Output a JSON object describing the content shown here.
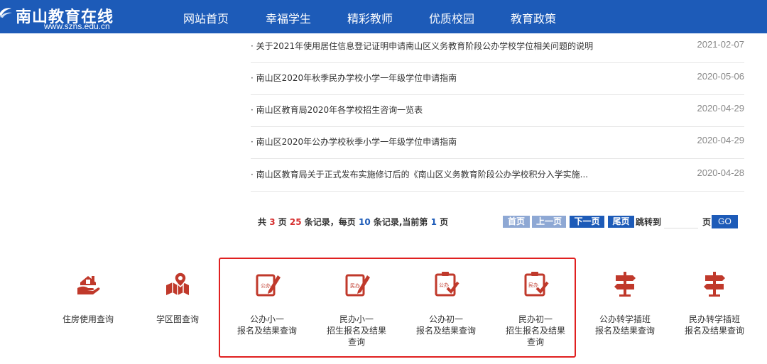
{
  "header": {
    "site_title": "南山教育在线",
    "site_url": "www.szns.edu.cn",
    "nav": [
      "网站首页",
      "幸福学生",
      "精彩教师",
      "优质校园",
      "教育政策"
    ]
  },
  "news": [
    {
      "title": "· 关于2021年使用居住信息登记证明申请南山区义务教育阶段公办学校学位相关问题的说明",
      "date": "2021-02-07"
    },
    {
      "title": "· 南山区2020年秋季民办学校小学一年级学位申请指南",
      "date": "2020-05-06"
    },
    {
      "title": "· 南山区教育局2020年各学校招生咨询一览表",
      "date": "2020-04-29"
    },
    {
      "title": "· 南山区2020年公办学校秋季小学一年级学位申请指南",
      "date": "2020-04-29"
    },
    {
      "title": "· 南山区教育局关于正式发布实施修订后的《南山区义务教育阶段公办学校积分入学实施...",
      "date": "2020-04-28"
    }
  ],
  "pager": {
    "t1": "共 ",
    "total_pages": "3",
    "t2": " 页 ",
    "total_records": "25",
    "t3": " 条记录，每页 ",
    "per_page": "10",
    "t4": " 条记录,当前第 ",
    "current": "1",
    "t5": " 页",
    "first": "首页",
    "prev": "上一页",
    "next": "下一页",
    "last": "尾页",
    "jump_label": "跳转到",
    "page_unit": "页",
    "go": "GO"
  },
  "services": [
    {
      "line1": "住房使用查询",
      "line2": "",
      "line3": "",
      "icon": "house-hand-icon"
    },
    {
      "line1": "学区图查询",
      "line2": "",
      "line3": "",
      "icon": "map-pin-icon"
    },
    {
      "line1": "公办小一",
      "line2": "报名及结果查询",
      "line3": "",
      "icon": "public-primary-icon",
      "badge": "公办"
    },
    {
      "line1": "民办小一",
      "line2": "招生报名及结果",
      "line3": "查询",
      "icon": "private-primary-icon",
      "badge": "民办"
    },
    {
      "line1": "公办初一",
      "line2": "报名及结果查询",
      "line3": "",
      "icon": "public-junior-icon",
      "badge": "公办"
    },
    {
      "line1": "民办初一",
      "line2": "招生报名及结果",
      "line3": "查询",
      "icon": "private-junior-icon",
      "badge": "民办"
    },
    {
      "line1": "公办转学插班",
      "line2": "报名及结果查询",
      "line3": "",
      "icon": "signpost-icon"
    },
    {
      "line1": "民办转学插班",
      "line2": "报名及结果查询",
      "line3": "",
      "icon": "signpost-icon"
    }
  ],
  "colors": {
    "header_bg": "#1d5bb8",
    "icon_red": "#c0392b",
    "highlight": "#e02020"
  }
}
